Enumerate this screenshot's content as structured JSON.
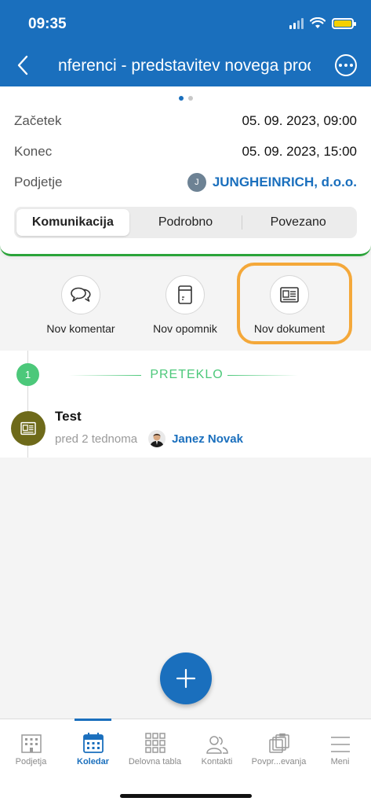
{
  "status_bar": {
    "time": "09:35"
  },
  "nav": {
    "title": "nferenci - predstavitev novega produ"
  },
  "details": {
    "start_label": "Začetek",
    "start_value": "05. 09. 2023, 09:00",
    "end_label": "Konec",
    "end_value": "05. 09. 2023, 15:00",
    "company_label": "Podjetje",
    "company_initial": "J",
    "company_value": "JUNGHEINRICH, d.o.o."
  },
  "tabs": [
    {
      "label": "Komunikacija",
      "active": true
    },
    {
      "label": "Podrobno",
      "active": false
    },
    {
      "label": "Povezano",
      "active": false
    }
  ],
  "actions": [
    {
      "label": "Nov komentar",
      "icon": "comment-icon"
    },
    {
      "label": "Nov opomnik",
      "icon": "reminder-icon"
    },
    {
      "label": "Nov dokument",
      "icon": "document-icon"
    }
  ],
  "timeline": {
    "count": "1",
    "section_title": "PRETEKLO",
    "item": {
      "title": "Test",
      "time": "pred 2 tednoma",
      "person": "Janez Novak"
    }
  },
  "bottom_nav": [
    {
      "label": "Podjetja",
      "icon": "building-icon",
      "active": false
    },
    {
      "label": "Koledar",
      "icon": "calendar-icon",
      "active": true
    },
    {
      "label": "Delovna tabla",
      "icon": "grid-icon",
      "active": false
    },
    {
      "label": "Kontakti",
      "icon": "contacts-icon",
      "active": false
    },
    {
      "label": "Povpr...evanja",
      "icon": "inquiries-icon",
      "active": false
    },
    {
      "label": "Meni",
      "icon": "menu-icon",
      "active": false
    }
  ],
  "colors": {
    "brand_blue": "#1a6fbd",
    "success_green": "#4cc87a",
    "highlight_orange": "#f4a83a"
  }
}
